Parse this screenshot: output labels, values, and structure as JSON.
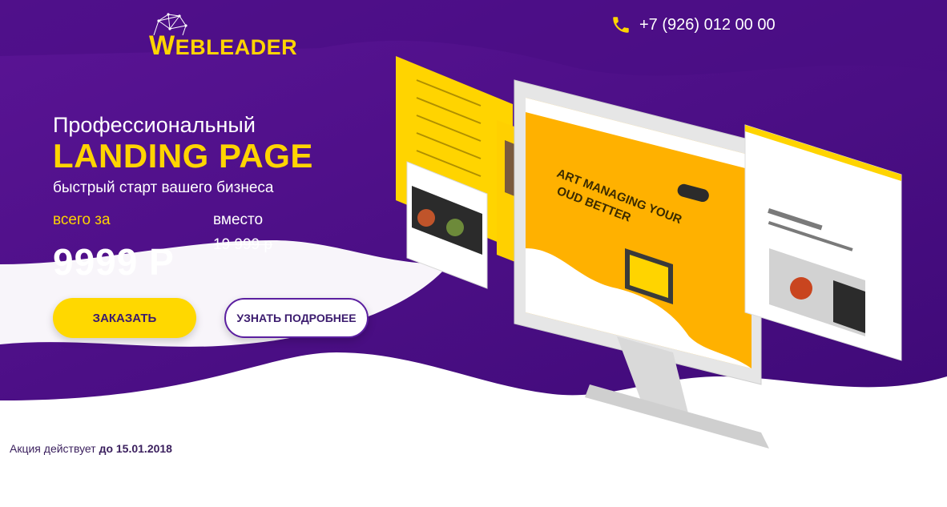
{
  "brand": {
    "logo_text_first": "W",
    "logo_text_rest": "EBLEADER"
  },
  "header": {
    "phone": "+7 (926) 012 00 00"
  },
  "hero": {
    "pre_title": "Профессиональный",
    "title": "LANDING PAGE",
    "subtitle": "быстрый старт вашего бизнеса",
    "price_label": "всего за",
    "price": "9999 Р",
    "old_label": "вместо",
    "old_price": "19 999 р"
  },
  "buttons": {
    "order": "ЗАКАЗАТЬ",
    "more": "УЗНАТЬ ПОДРОБНЕЕ"
  },
  "promo": {
    "text": "Акция действует ",
    "date": "до 15.01.2018"
  },
  "mockup": {
    "screen_headline_line1": "ART MANAGING YOUR",
    "screen_headline_line2": "OUD BETTER"
  },
  "colors": {
    "purple": "#4b0f86",
    "yellow": "#ffd400",
    "dark_text": "#3a1f5d"
  },
  "icons": [
    "phone-icon",
    "logo-mesh-icon"
  ]
}
